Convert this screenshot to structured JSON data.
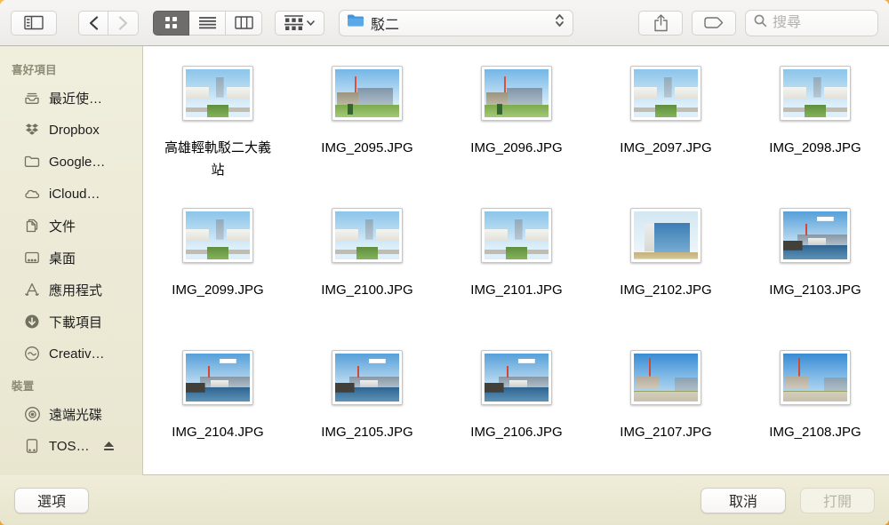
{
  "toolbar": {
    "folder_dropdown_label": "駁二",
    "search_placeholder": "搜尋"
  },
  "sidebar": {
    "sections": [
      {
        "header": "喜好項目",
        "items": [
          {
            "label": "最近使…",
            "icon": "recents-icon"
          },
          {
            "label": "Dropbox",
            "icon": "dropbox-icon"
          },
          {
            "label": "Google…",
            "icon": "folder-icon"
          },
          {
            "label": "iCloud…",
            "icon": "cloud-icon"
          },
          {
            "label": "文件",
            "icon": "document-icon"
          },
          {
            "label": "桌面",
            "icon": "desktop-icon"
          },
          {
            "label": "應用程式",
            "icon": "applications-icon"
          },
          {
            "label": "下載項目",
            "icon": "downloads-icon"
          },
          {
            "label": "Creativ…",
            "icon": "creative-cloud-icon"
          }
        ]
      },
      {
        "header": "裝置",
        "items": [
          {
            "label": "遠端光碟",
            "icon": "disc-icon"
          },
          {
            "label": "TOS…",
            "icon": "drive-icon",
            "eject": true
          }
        ]
      }
    ]
  },
  "files": [
    {
      "name": "高雄輕軌駁二大義站",
      "scene": "station"
    },
    {
      "name": "IMG_2095.JPG",
      "scene": "park"
    },
    {
      "name": "IMG_2096.JPG",
      "scene": "park"
    },
    {
      "name": "IMG_2097.JPG",
      "scene": "station"
    },
    {
      "name": "IMG_2098.JPG",
      "scene": "station"
    },
    {
      "name": "IMG_2099.JPG",
      "scene": "station"
    },
    {
      "name": "IMG_2100.JPG",
      "scene": "station"
    },
    {
      "name": "IMG_2101.JPG",
      "scene": "station"
    },
    {
      "name": "IMG_2102.JPG",
      "scene": "blue-building"
    },
    {
      "name": "IMG_2103.JPG",
      "scene": "harbor"
    },
    {
      "name": "IMG_2104.JPG",
      "scene": "harbor"
    },
    {
      "name": "IMG_2105.JPG",
      "scene": "harbor"
    },
    {
      "name": "IMG_2106.JPG",
      "scene": "harbor"
    },
    {
      "name": "IMG_2107.JPG",
      "scene": "construction"
    },
    {
      "name": "IMG_2108.JPG",
      "scene": "construction"
    }
  ],
  "footer": {
    "options_label": "選項",
    "cancel_label": "取消",
    "open_label": "打開"
  },
  "colors": {
    "folder_blue": "#59a8e8",
    "sidebar_tint": "#edebd8",
    "selected_segment": "#6e6d6c",
    "toolbar_gray": "#f1efed"
  }
}
